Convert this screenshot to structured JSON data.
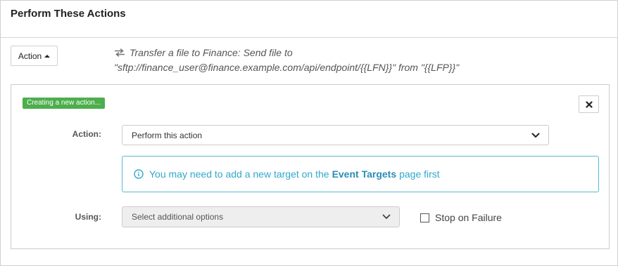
{
  "panel": {
    "title": "Perform These Actions"
  },
  "action_toggle": {
    "label": "Action",
    "icon": "caret-up-icon"
  },
  "summary": {
    "icon": "exchange-arrows-icon",
    "line1": "Transfer a file to Finance: Send file to",
    "line2": "\"sftp://finance_user@finance.example.com/api/endpoint/{{LFN}}\" from \"{{LFP}}\""
  },
  "editor": {
    "badge": "Creating a new action...",
    "close_icon": "close-icon",
    "action_label": "Action:",
    "action_value": "Perform this action",
    "info": {
      "icon": "info-circle-icon",
      "prefix": "You may need to add a new target on the",
      "link": "Event Targets",
      "suffix": "page first"
    },
    "using_label": "Using:",
    "using_value": "Select additional options",
    "stop_on_failure_label": "Stop on Failure",
    "stop_on_failure_checked": false
  },
  "colors": {
    "badge_green": "#4cae4c",
    "info_border": "#5ab6d3",
    "info_text": "#31a8cc",
    "link": "#2a8db5"
  }
}
